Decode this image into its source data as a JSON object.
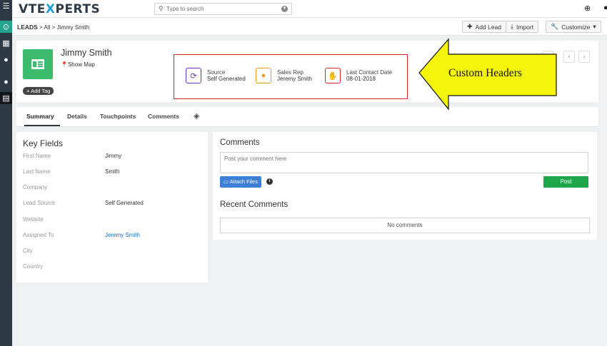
{
  "app": {
    "logo_prefix": "VTE",
    "logo_x": "X",
    "logo_suffix": "PERTS"
  },
  "search": {
    "placeholder": "Type to search"
  },
  "breadcrumb": {
    "module": "LEADS",
    "sep1": ">",
    "all": "All",
    "sep2": ">",
    "record": "Jimmy Smith"
  },
  "header_buttons": {
    "add_lead": "Add Lead",
    "import": "Import",
    "customize": "Customize"
  },
  "record": {
    "name": "Jimmy Smith",
    "show_map": "Show Map",
    "add_tag": "Add Tag"
  },
  "custom_headers": [
    {
      "label": "Source",
      "value": "Self Generated",
      "color": "#6a2ec7",
      "icon": "refresh-icon"
    },
    {
      "label": "Sales Rep",
      "value": "Jeremy Smith",
      "color": "#f09a1a",
      "icon": "user-icon"
    },
    {
      "label": "Last Contact Date",
      "value": "08-01-2018",
      "color": "#d9262d",
      "icon": "handshake-icon"
    }
  ],
  "tabs": [
    {
      "label": "Summary",
      "active": true
    },
    {
      "label": "Details"
    },
    {
      "label": "Touchpoints"
    },
    {
      "label": "Comments"
    }
  ],
  "key_fields": {
    "title": "Key Fields",
    "rows": [
      {
        "label": "First Name",
        "value": "Jimmy"
      },
      {
        "label": "Last Name",
        "value": "Smith"
      },
      {
        "label": "Company",
        "value": ""
      },
      {
        "label": "Lead Source",
        "value": "Self Generated"
      },
      {
        "label": "Website",
        "value": ""
      },
      {
        "label": "Assigned To",
        "value": "Jeremy Smith"
      },
      {
        "label": "City",
        "value": ""
      },
      {
        "label": "Country",
        "value": ""
      }
    ]
  },
  "comments": {
    "title": "Comments",
    "placeholder": "Post your comment here",
    "attach_label": "Attach Files",
    "post_label": "Post",
    "recent_title": "Recent Comments",
    "empty_text": "No comments"
  },
  "annotation": {
    "text": "Custom Headers",
    "arrow_color": "#f5f50a"
  },
  "colors": {
    "sidebar": "#2d3a45",
    "accent_teal": "#24a48e",
    "record_green": "#3dbb6c",
    "post_green": "#1fa64b",
    "attach_blue": "#3d7fd6"
  }
}
